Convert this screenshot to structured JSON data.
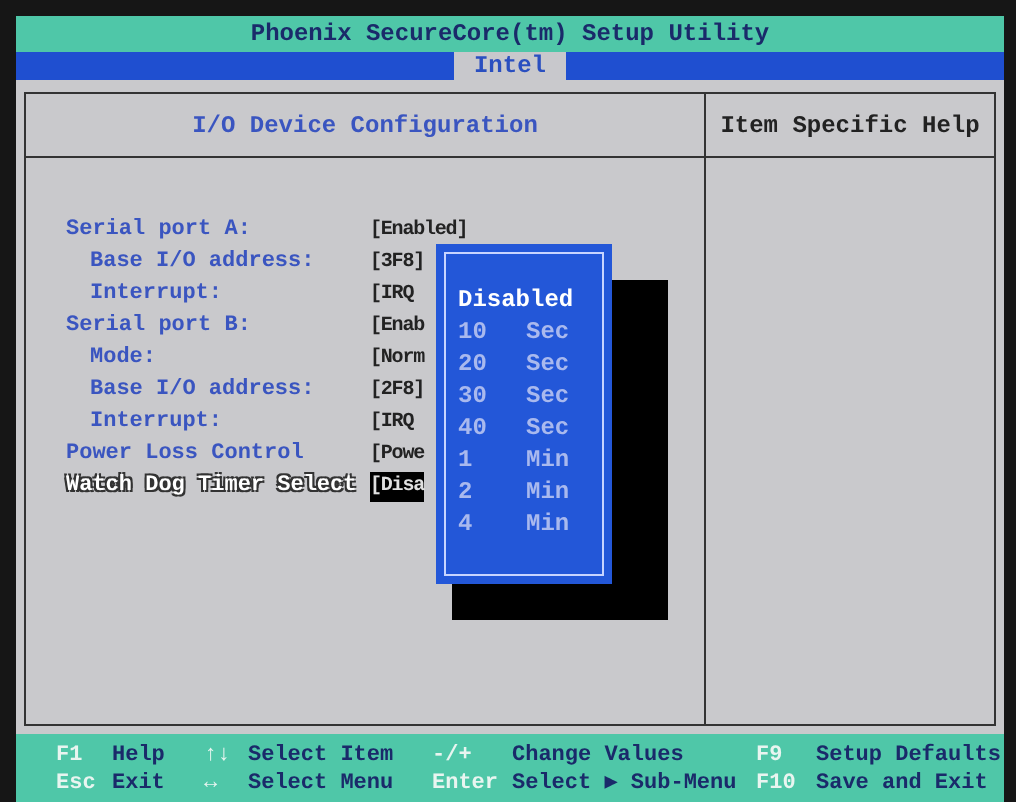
{
  "window": {
    "title": "Phoenix SecureCore(tm) Setup Utility"
  },
  "menu": [
    {
      "label": "Intel",
      "selected": true
    }
  ],
  "panel": {
    "title": "I/O Device Configuration",
    "help_title": "Item Specific Help"
  },
  "items": [
    {
      "kind": "section",
      "label": "Serial port A:",
      "value": "[Enabled]",
      "selected": false
    },
    {
      "kind": "sub",
      "label": "Base I/O address:",
      "value": "[3F8]",
      "selected": false
    },
    {
      "kind": "sub",
      "label": "Interrupt:",
      "value": "[IRQ",
      "selected": false
    },
    {
      "kind": "section",
      "label": "Serial port B:",
      "value": "[Enab",
      "selected": false
    },
    {
      "kind": "sub",
      "label": "Mode:",
      "value": "[Norm",
      "selected": false
    },
    {
      "kind": "sub",
      "label": "Base I/O address:",
      "value": "[2F8]",
      "selected": false
    },
    {
      "kind": "sub",
      "label": "Interrupt:",
      "value": "[IRQ",
      "selected": false
    },
    {
      "kind": "section",
      "label": "Power Loss Control",
      "value": "[Powe",
      "selected": false
    },
    {
      "kind": "section",
      "label": "Watch Dog Timer Select",
      "value": "[Disa",
      "selected": true
    }
  ],
  "popup": [
    {
      "amount": "Disabled",
      "selected": true
    },
    {
      "amount": "10",
      "unit": "Sec",
      "selected": false
    },
    {
      "amount": "20",
      "unit": "Sec",
      "selected": false
    },
    {
      "amount": "30",
      "unit": "Sec",
      "selected": false
    },
    {
      "amount": "40",
      "unit": "Sec",
      "selected": false
    },
    {
      "amount": "1",
      "unit": "Min",
      "selected": false
    },
    {
      "amount": "2",
      "unit": "Min",
      "selected": false
    },
    {
      "amount": "4",
      "unit": "Min",
      "selected": false
    }
  ],
  "keys": [
    [
      {
        "key": "F1",
        "action": "Help"
      },
      {
        "key": "↑↓",
        "action": "Select Item"
      },
      {
        "key": "-/+",
        "action": "Change Values"
      },
      {
        "key": "F9",
        "action": "Setup Defaults"
      }
    ],
    [
      {
        "key": "Esc",
        "action": "Exit"
      },
      {
        "key": "↔",
        "action": "Select Menu"
      },
      {
        "key": "Enter",
        "action": "Select ▶ Sub-Menu"
      },
      {
        "key": "F10",
        "action": "Save and Exit"
      }
    ]
  ]
}
